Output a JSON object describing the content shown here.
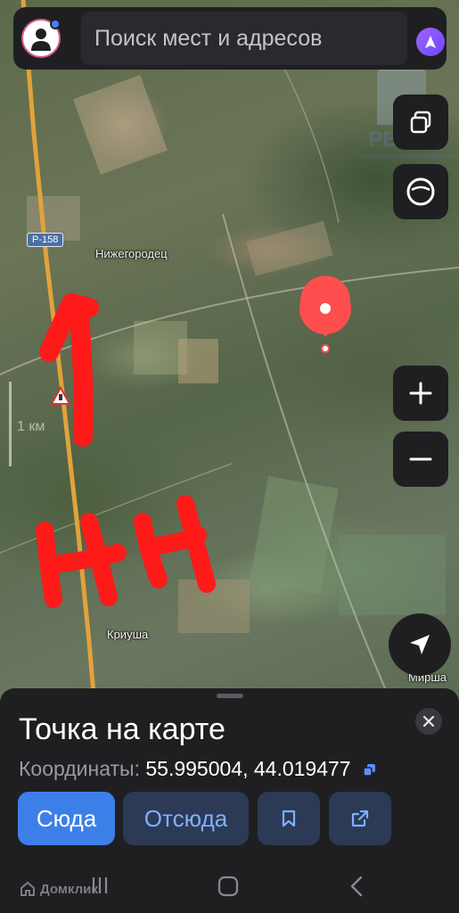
{
  "search": {
    "placeholder": "Поиск мест и адресов"
  },
  "map": {
    "labels": {
      "village_top": "Нижегородец",
      "village_bottom": "Криуша",
      "village_right": "Мирша"
    },
    "road_badge": "Р-158",
    "scale_label": "1 км",
    "annotation": {
      "text": "НН"
    },
    "watermark_top_right": "РБАН",
    "watermark_top_right_sub": "Агентство Недвижимости"
  },
  "controls": [
    "layers-button",
    "panorama-button",
    "zoom-in-button",
    "zoom-out-button",
    "my-location-button"
  ],
  "sheet": {
    "title": "Точка на карте",
    "coords_label": "Координаты:",
    "coords_value": "55.995004, 44.019477",
    "btn_here": "Сюда",
    "btn_from": "Отсюда"
  },
  "navbar": {
    "watermark": "Домклик",
    "buttons": [
      "recents",
      "home",
      "back"
    ]
  },
  "colors": {
    "pin": "#ff4e4e",
    "annotation": "#ff1a1a",
    "accent": "#3d7fe8",
    "sheet_bg": "#1f1f22"
  }
}
